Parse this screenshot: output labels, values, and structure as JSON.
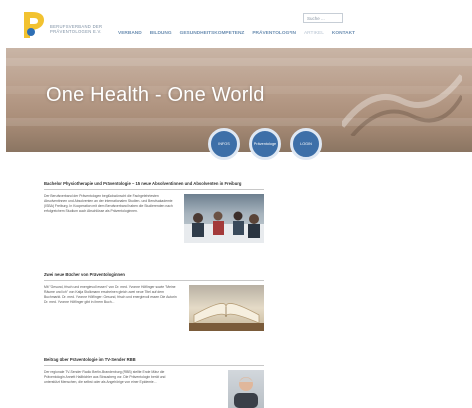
{
  "header": {
    "logo_text": "BERUFSVERBAND DER PRÄVENTOLOGEN E.V.",
    "search_placeholder": "Suche ...",
    "nav": [
      "VERBAND",
      "BILDUNG",
      "GESUNDHEITSKOMPETENZ",
      "PRÄVENTOLOG*IN",
      "ARTIKEL",
      "KONTAKT"
    ],
    "active_nav": "ARTIKEL"
  },
  "hero": {
    "title": "One Health - One World"
  },
  "circles": [
    {
      "label": "INFOS"
    },
    {
      "label": "Präventologe"
    },
    {
      "label": "LOGIN"
    }
  ],
  "articles": [
    {
      "title": "Bachelor Physiotherapie und Präventologie – 15 neue Absolventinnen und Absolventen in Freiburg",
      "text": "Der Berufsverband der Präventologen beglückwünscht die Fachgelehrtesten Absolventinnen und Absolventen an der internationalen Studien- und Berufsakademie (ISBA) Freiburg. In Kooperation mit dem Berufsverband haben die Studierenden nach erfolgreichem Studium auch Abschlüsse als Präventologinnen."
    },
    {
      "title": "Zwei neue Bücher von Präventologinnen",
      "text": "Mit \"Gesund, frisch und energievoll essen\" von Dr. med. Yvonne Höflinger sowie \"Meine Räume und ich\" von Katja Stolkmann erscheinen gleich zwei neue Titel auf dem Buchmarkt. Dr. med. Yvonne Höflinger: Gesund, frisch und energievoll essen Die Autorin Dr. med. Yvonne Höflinger gibt in ihrem Buch..."
    },
    {
      "title": "Beitrag über Präventologie im TV-Sender RBB",
      "text": "Der regionale TV-Sender Radio Berlin-Brandenburg (RBB) stellte Ende März die Präventologin Annett Hallbichler aus Strausberg vor. Die Präventologin berät und unterstützt Menschen, die selbst oder als Angehörige von einer Epidemie..."
    }
  ],
  "colors": {
    "accent": "#3d6fa8",
    "nav": "#6d8fb2",
    "logo_yellow": "#f2c230",
    "logo_blue": "#2e6fb5"
  }
}
